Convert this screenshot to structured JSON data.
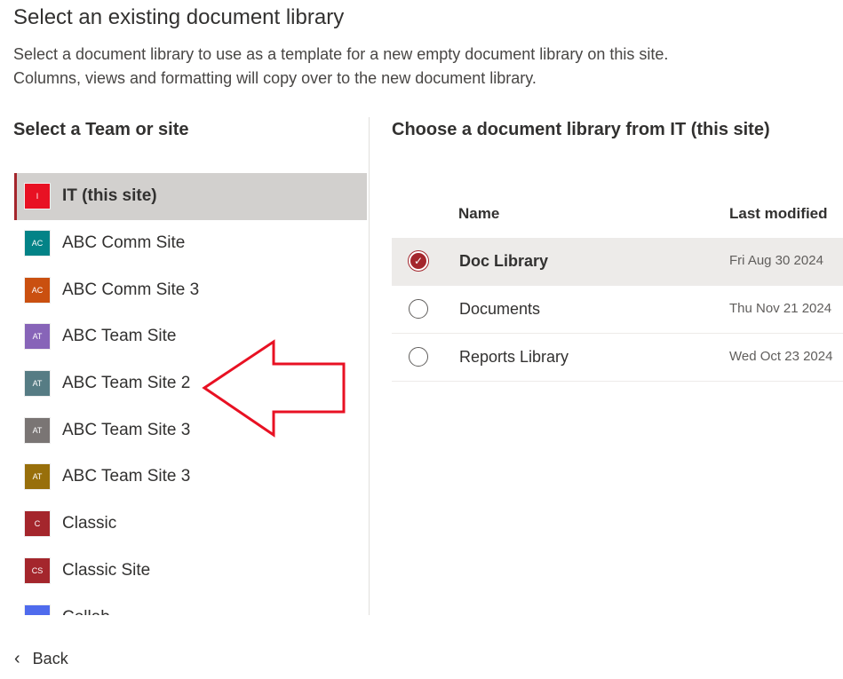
{
  "title": "Select an existing document library",
  "description": [
    "Select a document library to use as a template for a new empty document library on this site.",
    "Columns, views and formatting will copy over to the new document library."
  ],
  "left": {
    "heading": "Select a Team or site",
    "sites": [
      {
        "label": "IT (this site)",
        "initials": "I",
        "color": "#e81123",
        "selected": true
      },
      {
        "label": "ABC Comm Site",
        "initials": "AC",
        "color": "#038387"
      },
      {
        "label": "ABC Comm Site 3",
        "initials": "AC",
        "color": "#ca5010"
      },
      {
        "label": "ABC Team Site",
        "initials": "AT",
        "color": "#8764b8"
      },
      {
        "label": "ABC Team Site 2",
        "initials": "AT",
        "color": "#567c84"
      },
      {
        "label": "ABC Team Site 3",
        "initials": "AT",
        "color": "#7a7574"
      },
      {
        "label": "ABC Team Site 3",
        "initials": "AT",
        "color": "#986f0b"
      },
      {
        "label": "Classic",
        "initials": "C",
        "color": "#a4262c"
      },
      {
        "label": "Classic Site",
        "initials": "CS",
        "color": "#a4262c"
      },
      {
        "label": "Collab",
        "initials": "",
        "color": "#4f6bed"
      }
    ]
  },
  "right": {
    "heading": "Choose a document library from IT (this site)",
    "columns": {
      "name": "Name",
      "modified": "Last modified"
    },
    "rows": [
      {
        "name": "Doc Library",
        "modified": "Fri Aug 30 2024",
        "selected": true
      },
      {
        "name": "Documents",
        "modified": "Thu Nov 21 2024"
      },
      {
        "name": "Reports Library",
        "modified": "Wed Oct 23 2024"
      }
    ]
  },
  "back_label": "Back",
  "accent": "#a4262c",
  "annotation_color": "#e81123"
}
